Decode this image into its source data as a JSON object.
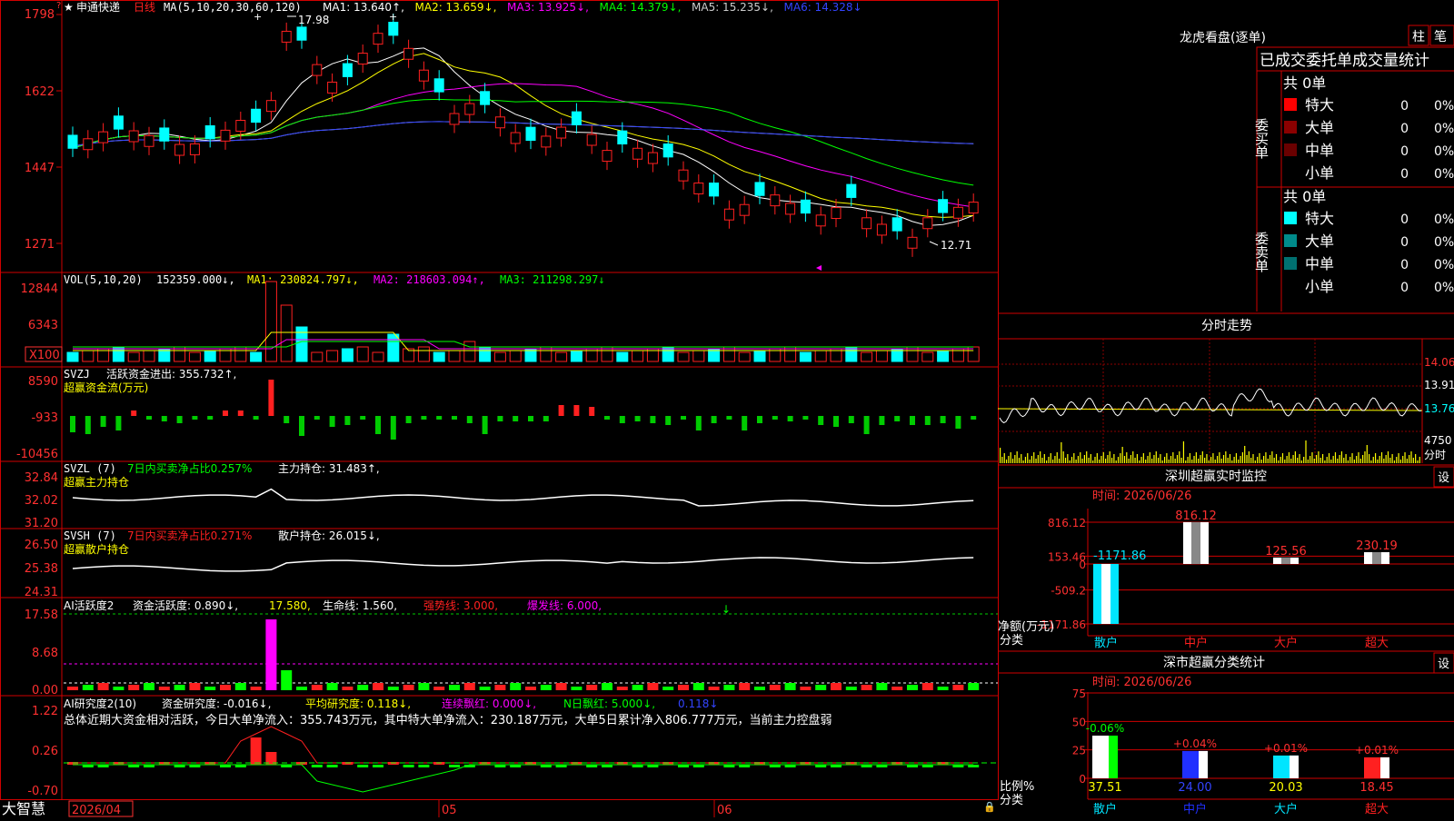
{
  "main": {
    "stock_name": "申通快递",
    "period": "日线",
    "ma_label": "MA(5,10,20,30,60,120)",
    "ma_values": [
      {
        "label": "MA1: 13.640↑,",
        "color": "#ffffff"
      },
      {
        "label": "MA2: 13.659↓,",
        "color": "#ffff00"
      },
      {
        "label": "MA3: 13.925↓,",
        "color": "#ff00ff"
      },
      {
        "label": "MA4: 14.379↓,",
        "color": "#00ff00"
      },
      {
        "label": "MA5: 15.235↓,",
        "color": "#cccccc"
      },
      {
        "label": "MA6: 14.328↓",
        "color": "#3344ff"
      }
    ],
    "y_ticks": [
      "1798",
      "1622",
      "1447",
      "1271"
    ],
    "high_label": "17.98",
    "low_label": "12.71"
  },
  "vol": {
    "title": "VOL(5,10,20)",
    "value": "152359.000↓,",
    "ma1": "MA1: 230824.797↓,",
    "ma2": "MA2: 218603.094↑,",
    "ma3": "MA3: 211298.297↓",
    "y_ticks": [
      "12844",
      "6343"
    ],
    "unit": "X100"
  },
  "svzj": {
    "title": "SVZJ",
    "text1": "活跃资金进出: 355.732↑,",
    "subtitle": "超赢资金流(万元)",
    "y_ticks": [
      "8590",
      "-933",
      "-10456"
    ]
  },
  "svzl": {
    "title": "SVZL (7)",
    "text1": "7日内买卖净占比0.257%",
    "text2": "主力持仓: 31.483↑,",
    "subtitle": "超赢主力持仓",
    "y_ticks": [
      "32.84",
      "32.02",
      "31.20"
    ]
  },
  "svsh": {
    "title": "SVSH (7)",
    "text1": "7日内买卖净占比0.271%",
    "text2": "散户持仓: 26.015↓,",
    "subtitle": "超赢散户持仓",
    "y_ticks": [
      "26.50",
      "25.38",
      "24.31"
    ]
  },
  "ai1": {
    "title": "AI活跃度2",
    "text1": "资金活跃度: 0.890↓,",
    "text2": "17.580,",
    "text3": "生命线: 1.560,",
    "text4": "强势线: 3.000,",
    "text5": "爆发线: 6.000,",
    "y_ticks": [
      "17.58",
      "8.68",
      "0.00"
    ]
  },
  "ai2": {
    "title": "AI研究度2(10)",
    "text1": "资金研究度: -0.016↓,",
    "text2": "平均研究度: 0.118↓,",
    "text3": "连续飘红: 0.000↓,",
    "text4": "N日飘红: 5.000↓,",
    "text5": "0.118↓",
    "summary": "总体近期大资金相对活跃，今日大单净流入：355.743万元，其中特大单净流入：230.187万元，大单5日累计净入806.777万元，当前主力控盘弱",
    "y_ticks": [
      "1.22",
      "0.26",
      "-0.70"
    ]
  },
  "bottom": {
    "brand": "大智慧",
    "date_label": "2026/04",
    "month_labels": [
      "05",
      "06"
    ]
  },
  "right": {
    "title": "龙虎看盘(逐单)",
    "btn_bar": "柱",
    "btn_single": "笔",
    "stats_header": "已成交委托单成交量统计",
    "buy_side": "委买单",
    "sell_side": "委卖单",
    "buy_total": "共 0单",
    "sell_total": "共 0单",
    "buy_rows": [
      {
        "label": "特大",
        "count": "0",
        "pct": "0%",
        "color": "#ff0000"
      },
      {
        "label": "大单",
        "count": "0",
        "pct": "0%",
        "color": "#8b0000"
      },
      {
        "label": "中单",
        "count": "0",
        "pct": "0%",
        "color": "#6a0000"
      },
      {
        "label": "小单",
        "count": "0",
        "pct": "0%",
        "color": "#000000"
      }
    ],
    "sell_rows": [
      {
        "label": "特大",
        "count": "0",
        "pct": "0%",
        "color": "#00ffff"
      },
      {
        "label": "大单",
        "count": "0",
        "pct": "0%",
        "color": "#008b8b"
      },
      {
        "label": "中单",
        "count": "0",
        "pct": "0%",
        "color": "#007070"
      },
      {
        "label": "小单",
        "count": "0",
        "pct": "0%",
        "color": "#000000"
      }
    ],
    "intraday_title": "分时走势",
    "intraday_ticks": [
      "14.06",
      "13.91",
      "13.76"
    ],
    "intraday_vol": "4750",
    "intraday_vol_unit": "分时",
    "monitor_title": "深圳超赢实时监控",
    "monitor_time": "时间: 2026/06/26",
    "monitor_btn": "设",
    "monitor_ticks": [
      "816.12",
      "153.46",
      "0",
      "-509.2",
      "-1171.86"
    ],
    "monitor_ylabel": "净额(万元)",
    "monitor_xlabel": "分类",
    "stats_title": "深市超赢分类统计",
    "stats_time": "时间: 2026/06/26",
    "stats_btn": "设",
    "stats_ticks": [
      "75",
      "50",
      "25",
      "0"
    ],
    "stats_ylabel": "比例%",
    "stats_xlabel": "分类"
  },
  "chart_data": [
    {
      "type": "bar",
      "title": "深圳超赢实时监控",
      "ylabel": "净额(万元)",
      "xlabel": "分类",
      "categories": [
        "散户",
        "中户",
        "大户",
        "超大"
      ],
      "values": [
        -1171.86,
        816.12,
        125.56,
        230.19
      ],
      "ylim": [
        -1171.86,
        816.12
      ],
      "colors": [
        "#00e5ff",
        "#ffffff",
        "#ffffff",
        "#ffffff"
      ],
      "category_colors": [
        "#00e5ff",
        "#ff2020",
        "#ff2020",
        "#ff2020"
      ]
    },
    {
      "type": "bar",
      "title": "深市超赢分类统计",
      "ylabel": "比例%",
      "xlabel": "分类",
      "categories": [
        "散户",
        "中户",
        "大户",
        "超大"
      ],
      "values": [
        37.51,
        24.0,
        20.03,
        18.45
      ],
      "changes": [
        "-0.06%",
        "+0.04%",
        "+0.01%",
        "+0.01%"
      ],
      "ylim": [
        0,
        75
      ],
      "colors": [
        "#ffffff",
        "#2030ff",
        "#00e5ff",
        "#ff2020"
      ],
      "accent_colors": [
        "#00ff00",
        "#ffffff",
        "#ffffff",
        "#ffffff"
      ],
      "category_colors": [
        "#00e5ff",
        "#2030ff",
        "#00e5ff",
        "#ff2020"
      ]
    }
  ]
}
